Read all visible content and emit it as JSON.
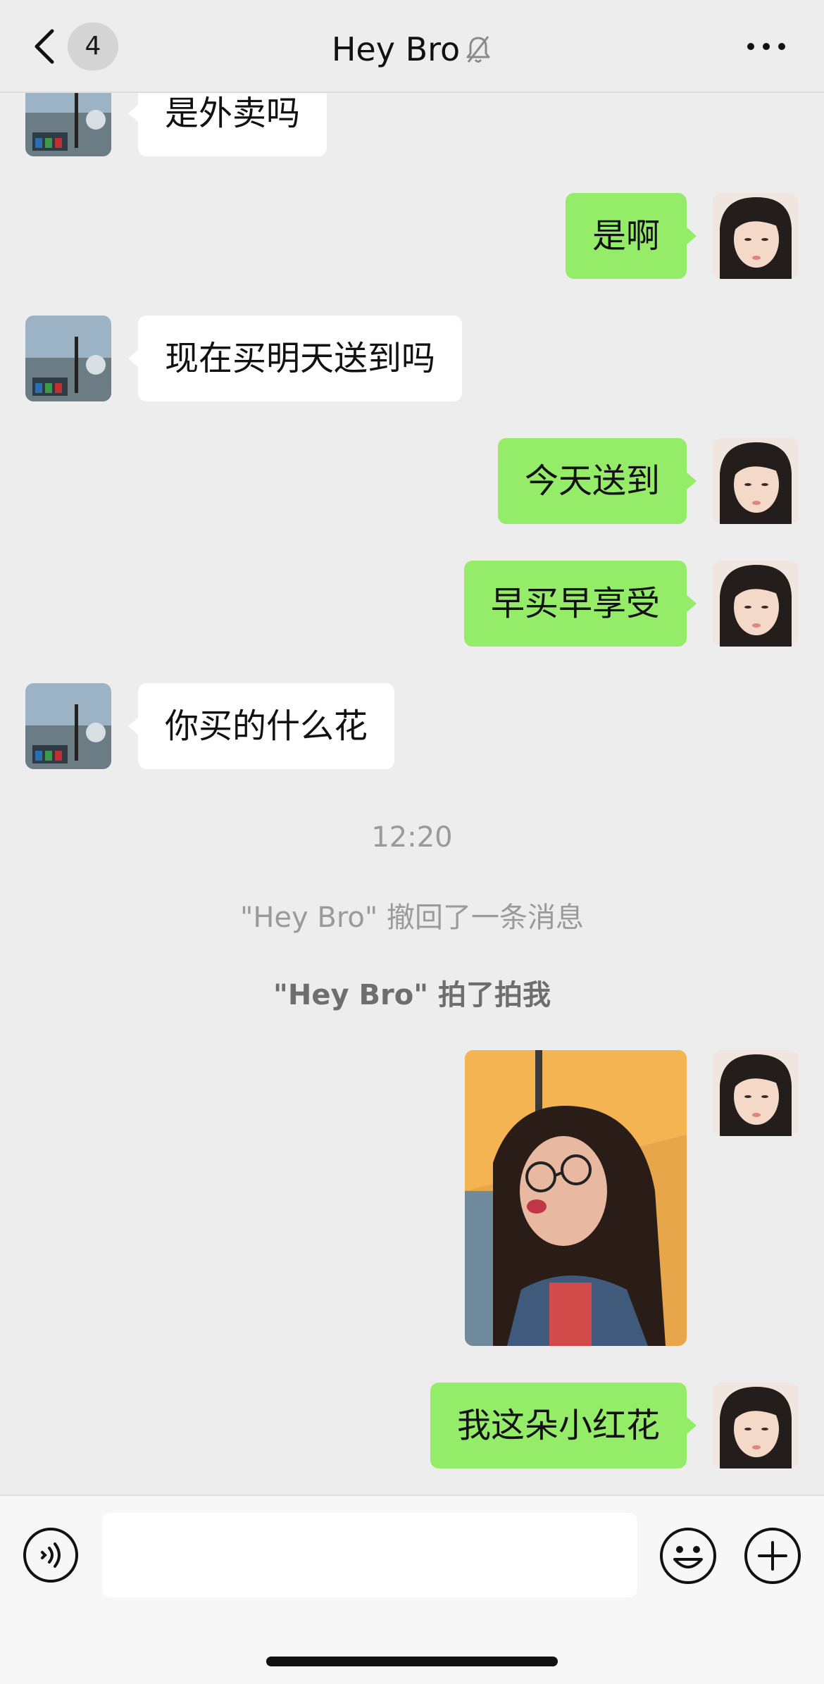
{
  "header": {
    "unread_count": "4",
    "title": "Hey Bro",
    "back_icon": "chevron-left-icon",
    "mute_icon": "bell-slash-icon",
    "more_icon": "more-horizontal-icon"
  },
  "messages": [
    {
      "side": "left",
      "text": "是外卖吗"
    },
    {
      "side": "right",
      "text": "是啊"
    },
    {
      "side": "left",
      "text": "现在买明天送到吗"
    },
    {
      "side": "right",
      "text": "今天送到"
    },
    {
      "side": "right",
      "text": "早买早享受"
    },
    {
      "side": "left",
      "text": "你买的什么花"
    }
  ],
  "system": {
    "timestamp": "12:20",
    "recall_notice": "\"Hey Bro\" 撤回了一条消息",
    "pat_notice": "\"Hey Bro\" 拍了拍我"
  },
  "last_message": {
    "side": "right",
    "text": "我这朵小红花"
  },
  "input_bar": {
    "voice_icon": "voice-icon",
    "emoji_icon": "emoji-icon",
    "plus_icon": "plus-icon",
    "text_value": ""
  },
  "colors": {
    "background": "#ededed",
    "outgoing_bubble": "#95ec69",
    "incoming_bubble": "#ffffff"
  }
}
